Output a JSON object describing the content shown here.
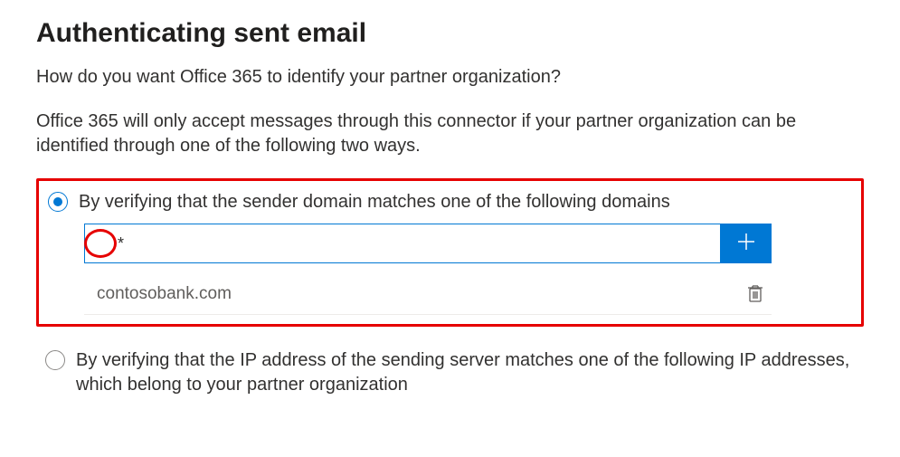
{
  "heading": "Authenticating sent email",
  "subtitle": "How do you want Office 365 to identify your partner organization?",
  "description": "Office 365 will only accept messages through this connector if your partner organization can be identified through one of the following two ways.",
  "options": {
    "by_domain": {
      "label": "By verifying that the sender domain matches one of the following domains",
      "selected": true,
      "input_value": "*",
      "domains": [
        "contosobank.com"
      ]
    },
    "by_ip": {
      "label": "By verifying that the IP address of the sending server matches one of the following IP addresses, which belong to your partner organization",
      "selected": false
    }
  },
  "annotations": {
    "highlight_domain_section": true,
    "circle_input_value": true
  },
  "colors": {
    "accent": "#0078d4",
    "annotation": "#e60000"
  }
}
